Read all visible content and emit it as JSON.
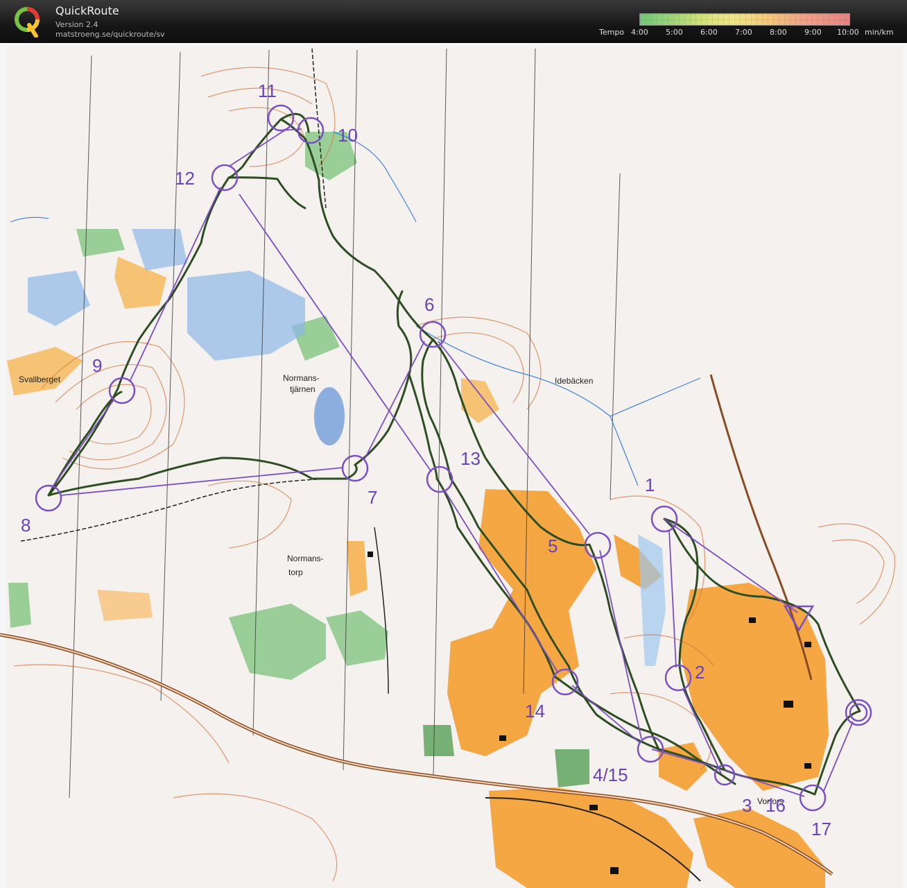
{
  "header": {
    "title": "QuickRoute",
    "version": "Version 2.4",
    "url": "matstroeng.se/quickroute/sv",
    "tempo_label": "Tempo",
    "tempo_ticks": [
      "4:00",
      "5:00",
      "6:00",
      "7:00",
      "8:00",
      "9:00",
      "10:00"
    ],
    "tempo_unit": "min/km",
    "tempo_colors": [
      "#72c87a",
      "#d5e279",
      "#f3c77c",
      "#e58585"
    ]
  },
  "map": {
    "labels": {
      "svallberget": "Svallberget",
      "normanstjarnen_1": "Normans-",
      "normanstjarnen_2": "tjärnen",
      "idebacken": "Idebäcken",
      "normanstorp_1": "Normans-",
      "normanstorp_2": "torp",
      "vorfors": "Vorfors"
    },
    "controls": {
      "c1": "1",
      "c2": "2",
      "c3": "3",
      "c4_15": "4/15",
      "c5": "5",
      "c6": "6",
      "c7": "7",
      "c8": "8",
      "c9": "9",
      "c10": "10",
      "c11": "11",
      "c12": "12",
      "c13": "13",
      "c14": "14",
      "c16": "16",
      "c17": "17"
    },
    "colors": {
      "course": "#7b4fc4",
      "route": "#2e4d23",
      "open_land": "#f4a23a",
      "forest_green": "#7cc27a",
      "water": "#8fb8e8",
      "contour": "#d9773e"
    }
  }
}
